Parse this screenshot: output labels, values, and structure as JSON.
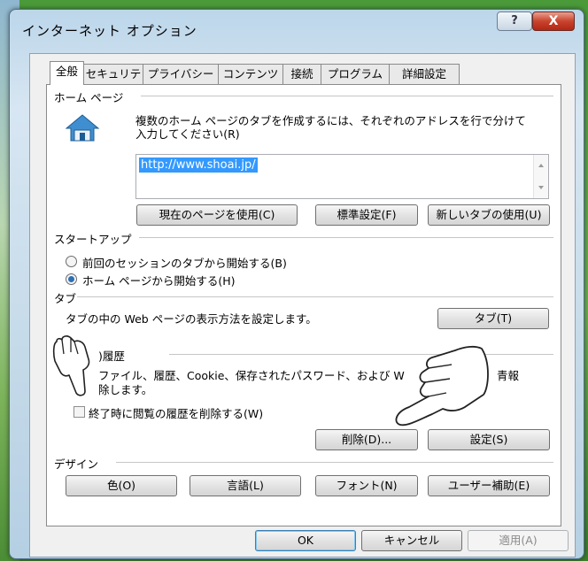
{
  "window": {
    "title": "インターネット オプション",
    "help_label": "?",
    "close_label": "X"
  },
  "tabs": [
    {
      "label": "全般",
      "active": true
    },
    {
      "label": "セキュリティ"
    },
    {
      "label": "プライバシー"
    },
    {
      "label": "コンテンツ"
    },
    {
      "label": "接続"
    },
    {
      "label": "プログラム"
    },
    {
      "label": "詳細設定"
    }
  ],
  "home": {
    "group_label": "ホーム ページ",
    "desc1": "複数のホーム ページのタブを作成するには、それぞれのアドレスを行で分けて",
    "desc2": "入力してください(R)",
    "url": "http://www.shoai.jp/",
    "use_current": "現在のページを使用(C)",
    "use_default": "標準設定(F)",
    "use_new_tab": "新しいタブの使用(U)"
  },
  "startup": {
    "group_label": "スタートアップ",
    "option1": "前回のセッションのタブから開始する(B)",
    "option2": "ホーム ページから開始する(H)",
    "selected": "option2"
  },
  "tabs_section": {
    "group_label": "タブ",
    "desc": "タブの中の Web ページの表示方法を設定します。",
    "button": "タブ(T)"
  },
  "history": {
    "group_label": "閲覧の履歴",
    "visible_group_label": ")履歴",
    "desc1": "一時ファイル、履歴、Cookie、保存されたパスワード、および Web フォームの情報",
    "desc1_visible_a": "ファイル、履歴、Cookie、保存されたパスワード、および W",
    "desc1_visible_b": "青報",
    "desc2_visible": "除します。",
    "checkbox_label": "終了時に閲覧の履歴を削除する(W)",
    "delete_button": "削除(D)...",
    "settings_button": "設定(S)"
  },
  "design": {
    "group_label": "デザイン",
    "colors": "色(O)",
    "languages": "言語(L)",
    "fonts": "フォント(N)",
    "accessibility": "ユーザー補助(E)"
  },
  "footer": {
    "ok": "OK",
    "cancel": "キャンセル",
    "apply": "適用(A)"
  },
  "colors": {
    "selection": "#3399ff",
    "close_red": "#c9432d"
  },
  "icons": [
    "help-icon",
    "close-icon",
    "home-icon",
    "pointing-hand-icon"
  ]
}
